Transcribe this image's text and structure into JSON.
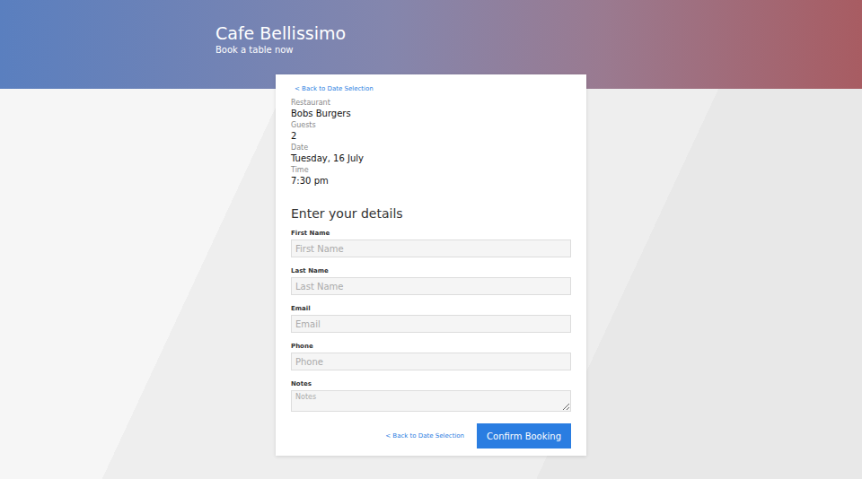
{
  "header": {
    "title": "Cafe Bellissimo",
    "subtitle": "Book a table now"
  },
  "back_link_top": "< Back to Date Selection",
  "summary": [
    {
      "label": "Restaurant",
      "value": "Bobs Burgers"
    },
    {
      "label": "Guests",
      "value": "2"
    },
    {
      "label": "Date",
      "value": "Tuesday, 16 July"
    },
    {
      "label": "Time",
      "value": "7:30 pm"
    }
  ],
  "form": {
    "heading": "Enter your details",
    "fields": [
      {
        "label": "First Name",
        "placeholder": "First Name",
        "kind": "input"
      },
      {
        "label": "Last Name",
        "placeholder": "Last Name",
        "kind": "input"
      },
      {
        "label": "Email",
        "placeholder": "Email",
        "kind": "input"
      },
      {
        "label": "Phone",
        "placeholder": "Phone",
        "kind": "input"
      },
      {
        "label": "Notes",
        "placeholder": "Notes",
        "kind": "textarea"
      }
    ]
  },
  "footer": {
    "back_link": "< Back to Date Selection",
    "confirm_button": "Confirm Booking"
  }
}
